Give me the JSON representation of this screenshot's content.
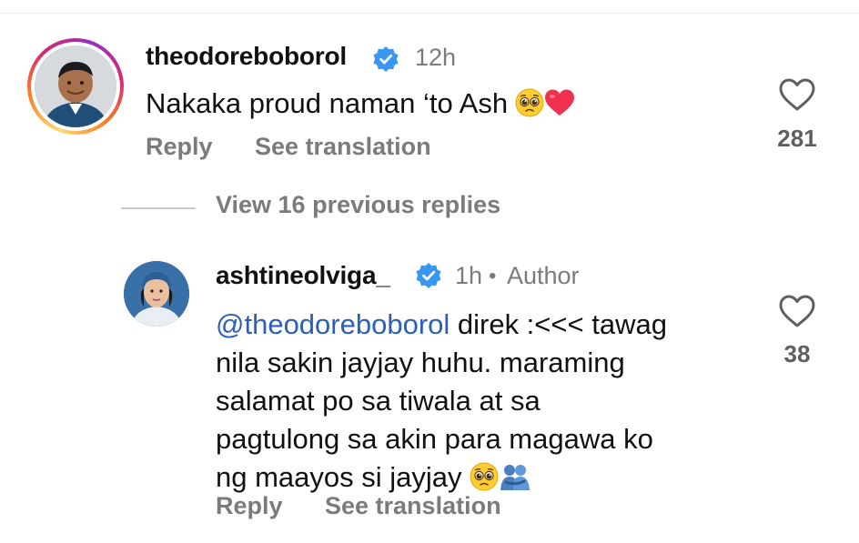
{
  "comment": {
    "username": "theodoreboborol",
    "time": "12h",
    "text": "Nakaka proud naman ‘to Ash",
    "reply_label": "Reply",
    "translate_label": "See translation",
    "likes": "281"
  },
  "view_replies_label": "View 16 previous replies",
  "reply": {
    "username": "ashtineolviga_",
    "time": "1h",
    "separator": "•",
    "author_label": "Author",
    "mention": "@theodoreboborol",
    "line1_rest": " direk :<<< tawag",
    "line2": "nila sakin jayjay huhu. maraming",
    "line3": "salamat po sa tiwala at sa",
    "line4": "pagtulong sa akin para magawa ko",
    "line5": "ng maayos si jayjay",
    "reply_label": "Reply",
    "translate_label": "See translation",
    "likes": "38"
  },
  "icons": {
    "verified": "verified-badge-icon",
    "like": "heart-outline-icon",
    "emoji_1": "pleading-face-emoji",
    "emoji_2": "red-heart-emoji",
    "emoji_3": "people-hugging-emoji"
  },
  "colors": {
    "verified_blue": "#3897f0",
    "mention_blue": "#2b5fb9",
    "muted_text": "#7b7b7b",
    "heart_red": "#f0304f"
  }
}
